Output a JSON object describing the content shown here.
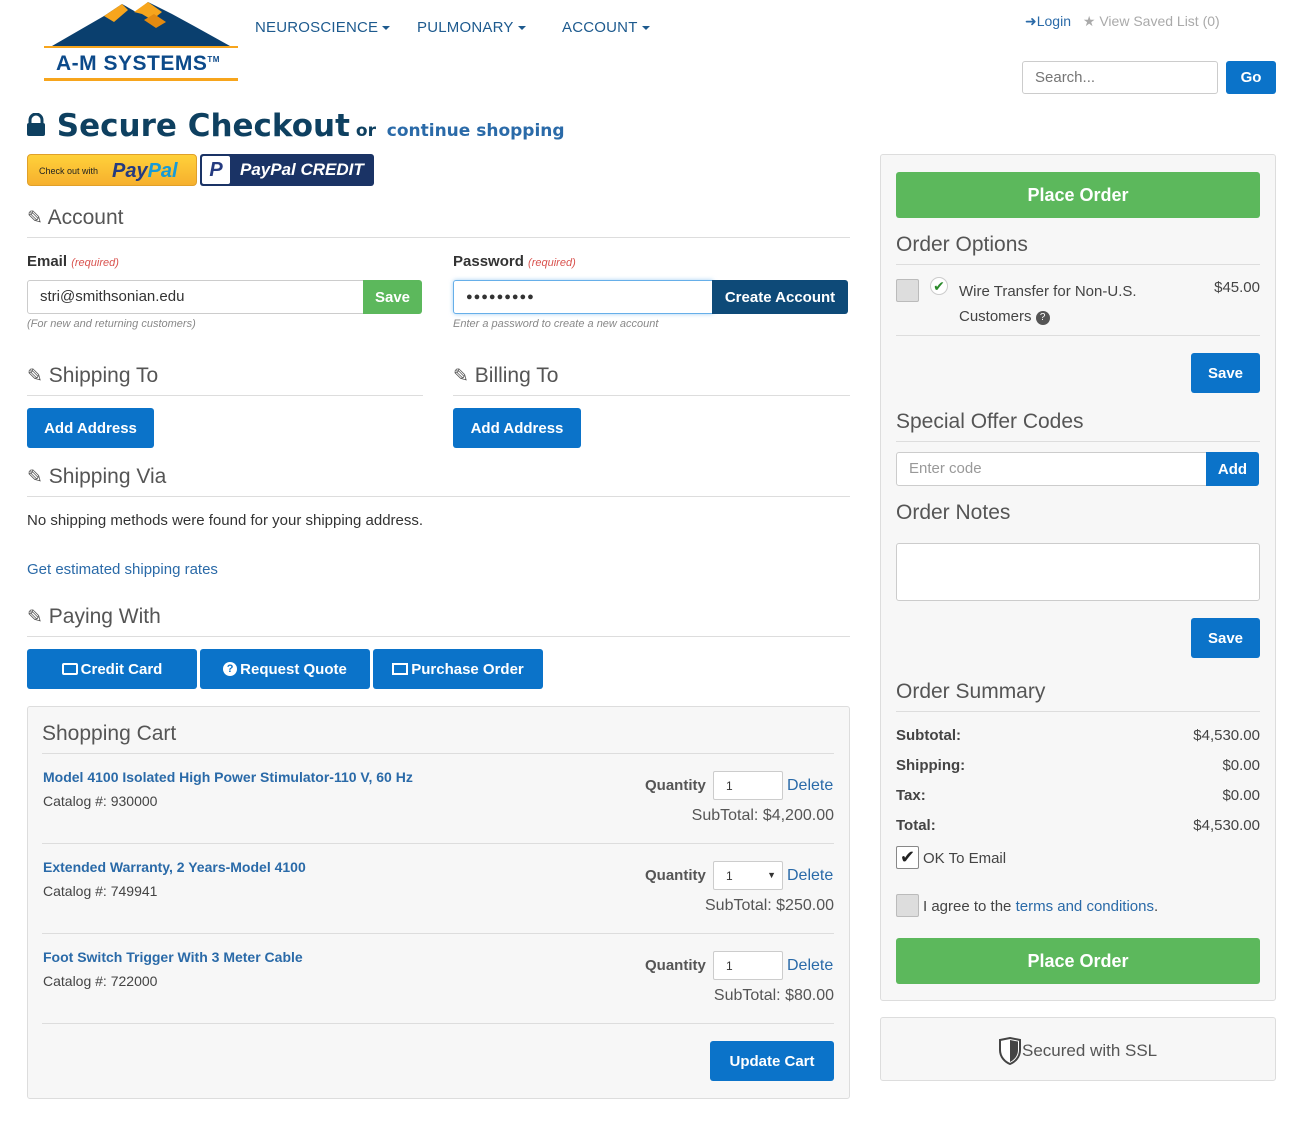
{
  "brand": {
    "logo_text": "A-M SYSTEMS",
    "tm": "TM"
  },
  "nav": {
    "items": [
      "NEUROSCIENCE",
      "PULMONARY",
      "ACCOUNT"
    ]
  },
  "header": {
    "login": "Login",
    "saved_list": "View Saved List (0)",
    "search_placeholder": "Search...",
    "go": "Go"
  },
  "checkout": {
    "title": "Secure Checkout",
    "or": "or",
    "continue": "continue shopping",
    "paypal_checkout": "Check out with",
    "paypal_brand_a": "Pay",
    "paypal_brand_b": "Pal",
    "paypal_credit": "PayPal CREDIT"
  },
  "account": {
    "heading": "Account",
    "email_label": "Email",
    "password_label": "Password",
    "required": "(required)",
    "email_value": "stri@smithsonian.edu",
    "password_value": "●●●●●●●●●",
    "email_help": "(For new and returning customers)",
    "password_help": "Enter a password to create a new account",
    "save": "Save",
    "create": "Create Account"
  },
  "shipping_to": {
    "heading": "Shipping To",
    "button": "Add Address"
  },
  "billing_to": {
    "heading": "Billing To",
    "button": "Add Address"
  },
  "shipping_via": {
    "heading": "Shipping Via",
    "message": "No shipping methods were found for your shipping address.",
    "link": "Get estimated shipping rates"
  },
  "paying_with": {
    "heading": "Paying With",
    "options": [
      "Credit Card",
      "Request Quote",
      "Purchase Order"
    ]
  },
  "cart": {
    "title": "Shopping Cart",
    "qty_label": "Quantity",
    "delete": "Delete",
    "items": [
      {
        "name": "Model 4100 Isolated High Power Stimulator-110 V, 60 Hz",
        "catalog": "Catalog #: 930000",
        "qty": "1",
        "subtotal": "SubTotal: $4,200.00"
      },
      {
        "name": "Extended Warranty, 2 Years-Model 4100",
        "catalog": "Catalog #: 749941",
        "qty": "1",
        "subtotal": "SubTotal: $250.00"
      },
      {
        "name": "Foot Switch Trigger With 3 Meter Cable",
        "catalog": "Catalog #: 722000",
        "qty": "1",
        "subtotal": "SubTotal: $80.00"
      }
    ],
    "update": "Update Cart"
  },
  "order": {
    "place_order": "Place Order",
    "options_heading": "Order Options",
    "wire_label_1": "Wire Transfer for Non-U.S.",
    "wire_label_2": "Customers",
    "wire_price": "$45.00",
    "save": "Save",
    "offer_heading": "Special Offer Codes",
    "code_placeholder": "Enter code",
    "add": "Add",
    "notes_heading": "Order Notes",
    "summary_heading": "Order Summary",
    "subtotal_label": "Subtotal:",
    "subtotal": "$4,530.00",
    "shipping_label": "Shipping:",
    "shipping": "$0.00",
    "tax_label": "Tax:",
    "tax": "$0.00",
    "total_label": "Total:",
    "total": "$4,530.00",
    "ok_email": "OK To Email",
    "agree_prefix": "I agree to the",
    "terms": "terms and conditions",
    "agree_suffix": "."
  },
  "ssl": {
    "text": "Secured with SSL"
  },
  "colors": {
    "primary": "#0b73c9",
    "success": "#5cb85c",
    "navy": "#0e4a78",
    "link": "#2a6aa8"
  }
}
